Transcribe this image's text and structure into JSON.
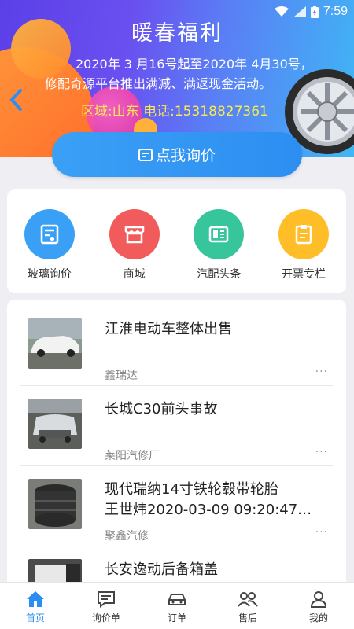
{
  "status_bar": {
    "time": "7:59"
  },
  "banner": {
    "title": "暖春福利",
    "line1": "2020年 3 月16号起至2020年 4月30号，",
    "line2": "修配奇源平台推出满减、满返现金活动。",
    "region": "区域:山东  电话:15318827361"
  },
  "inquiry_button": {
    "label": "点我询价"
  },
  "shortcuts": [
    {
      "label": "玻璃询价",
      "color": "#3aa0f5",
      "icon": "form-icon"
    },
    {
      "label": "商城",
      "color": "#f25b5b",
      "icon": "store-icon"
    },
    {
      "label": "汽配头条",
      "color": "#37c59c",
      "icon": "newspaper-icon"
    },
    {
      "label": "开票专栏",
      "color": "#ffbd28",
      "icon": "invoice-icon"
    }
  ],
  "list": [
    {
      "title": "江淮电动车整体出售",
      "subtitle": "",
      "shop": "鑫瑞达",
      "more": "···"
    },
    {
      "title": "长城C30前头事故",
      "subtitle": "",
      "shop": "莱阳汽修厂",
      "more": "···"
    },
    {
      "title": "现代瑞纳14寸铁轮毂带轮胎",
      "subtitle": "王世炜2020-03-09 09:20:47…",
      "shop": "聚鑫汽修",
      "more": "···"
    },
    {
      "title": "长安逸动后备箱盖",
      "subtitle": "",
      "shop": "",
      "more": ""
    }
  ],
  "tabs": [
    {
      "label": "首页",
      "icon": "home-icon",
      "active": true
    },
    {
      "label": "询价单",
      "icon": "message-icon",
      "active": false
    },
    {
      "label": "订单",
      "icon": "car-icon",
      "active": false
    },
    {
      "label": "售后",
      "icon": "people-icon",
      "active": false
    },
    {
      "label": "我的",
      "icon": "user-icon",
      "active": false
    }
  ],
  "colors": {
    "accent": "#2d8ef2",
    "region_text": "#f8ea4f"
  }
}
